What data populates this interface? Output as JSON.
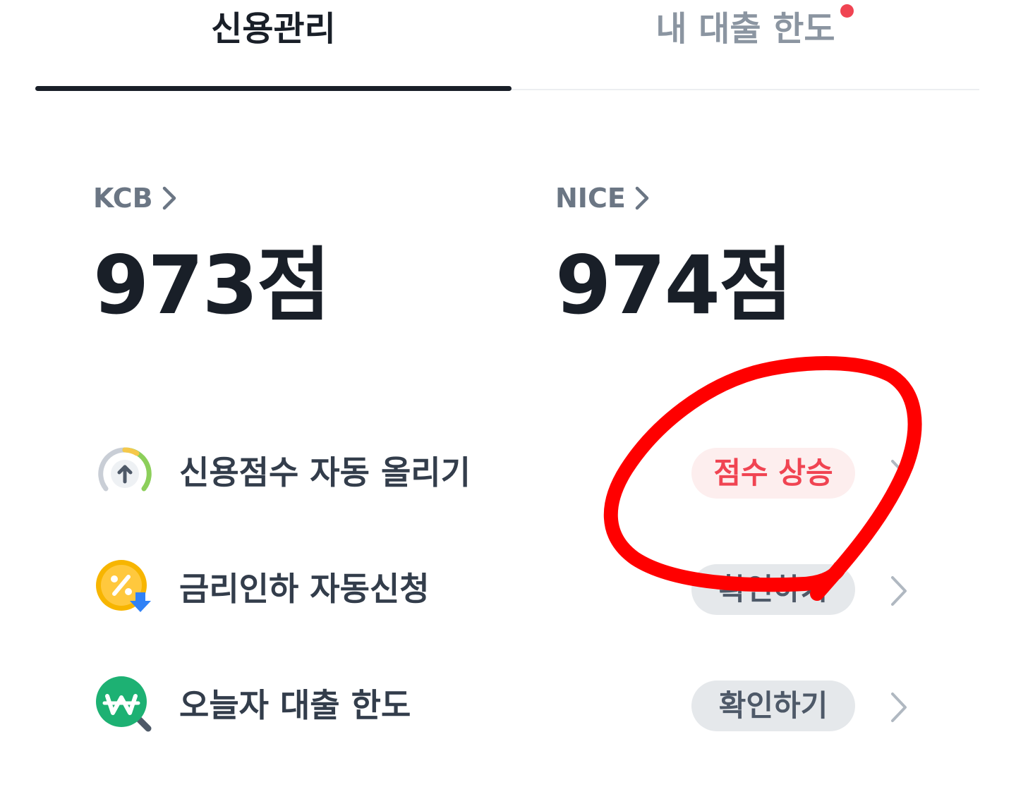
{
  "tabs": {
    "credit_label": "신용관리",
    "limit_label": "내 대출 한도",
    "active": "신용관리",
    "limit_has_new_badge": true
  },
  "scores": {
    "kcb": {
      "name": "KCB",
      "value": "973점"
    },
    "nice": {
      "name": "NICE",
      "value": "974점"
    }
  },
  "rows": [
    {
      "title": "신용점수 자동 올리기",
      "action": "점수 상승",
      "icon": "gauge-arrow-up-icon",
      "action_style": "red"
    },
    {
      "title": "금리인하 자동신청",
      "action": "확인하기",
      "icon": "percent-coin-down-icon",
      "action_style": "gray"
    },
    {
      "title": "오늘자 대출 한도",
      "action": "확인하기",
      "icon": "won-search-icon",
      "action_style": "gray"
    }
  ],
  "colors": {
    "text_primary": "#191f28",
    "text_secondary": "#6b7684",
    "text_tab_inactive": "#8b95a1",
    "accent_red": "#f04452",
    "pill_red_bg": "#fdeeee",
    "pill_gray_bg": "#e5e8eb",
    "annotation_red": "#ff0000"
  }
}
